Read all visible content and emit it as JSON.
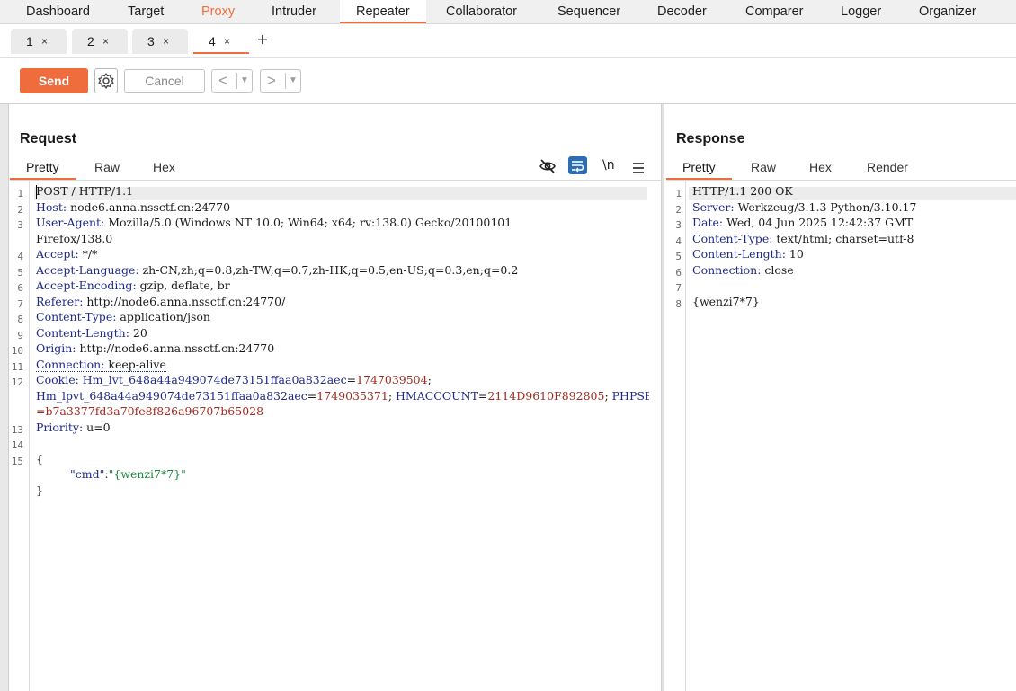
{
  "topnav": {
    "tabs": [
      "Dashboard",
      "Target",
      "Proxy",
      "Intruder",
      "Repeater",
      "Collaborator",
      "Sequencer",
      "Decoder",
      "Comparer",
      "Logger",
      "Organizer"
    ],
    "active": "Repeater",
    "highlight": "Proxy"
  },
  "repeater_tabs": [
    {
      "label": "1",
      "close": "×"
    },
    {
      "label": "2",
      "close": "×"
    },
    {
      "label": "3",
      "close": "×"
    },
    {
      "label": "4",
      "close": "×"
    }
  ],
  "new_tab": "+",
  "toolbar": {
    "send": "Send",
    "settings_icon": "gear-icon",
    "cancel": "Cancel",
    "back": "<",
    "forward": ">",
    "dropdown": "▼"
  },
  "request": {
    "title": "Request",
    "tabs": [
      "Pretty",
      "Raw",
      "Hex"
    ],
    "active_tab": "Pretty",
    "tool_icons": [
      "hide-icon",
      "wrap-icon",
      "newline-icon",
      "menu-icon"
    ],
    "newline_label": "\\n",
    "line_numbers": [
      "1",
      "2",
      "3",
      "4",
      "5",
      "6",
      "7",
      "8",
      "9",
      "10",
      "11",
      "12",
      "13",
      "14",
      "15"
    ],
    "request_line": "POST / HTTP/1.1",
    "headers": [
      {
        "name": "Host",
        "value": "node6.anna.nssctf.cn:24770"
      },
      {
        "name": "User-Agent",
        "value": "Mozilla/5.0 (Windows NT 10.0; Win64; x64; rv:138.0) Gecko/20100101",
        "cont": "Firefox/138.0"
      },
      {
        "name": "Accept",
        "value": "*/*"
      },
      {
        "name": "Accept-Language",
        "value": "zh-CN,zh;q=0.8,zh-TW;q=0.7,zh-HK;q=0.5,en-US;q=0.3,en;q=0.2"
      },
      {
        "name": "Accept-Encoding",
        "value": "gzip, deflate, br"
      },
      {
        "name": "Referer",
        "value": "http://node6.anna.nssctf.cn:24770/"
      },
      {
        "name": "Content-Type",
        "value": "application/json"
      },
      {
        "name": "Content-Length",
        "value": "20"
      },
      {
        "name": "Origin",
        "value": "http://node6.anna.nssctf.cn:24770"
      },
      {
        "name": "Connection",
        "value": "keep-alive"
      }
    ],
    "cookie": {
      "name": "Cookie",
      "c1_name": "Hm_lvt_648a44a949074de73151ffaa0a832aec",
      "c1_value": "1747039504",
      "c2_name": "Hm_lpvt_648a44a949074de73151ffaa0a832aec",
      "c2_value": "1749035371",
      "c3_name": "HMACCOUNT",
      "c3_value": "2114D9610F892805",
      "c4_name": "PHPSE",
      "c4_cont": "=b7a3377fd3a70fe8f826a96707b65028"
    },
    "priority": {
      "name": "Priority",
      "value": "u=0"
    },
    "body": {
      "open": "{",
      "key": "\"cmd\"",
      "colon": ":",
      "value": "\"{wenzi7*7}\"",
      "close": "}"
    }
  },
  "response": {
    "title": "Response",
    "tabs": [
      "Pretty",
      "Raw",
      "Hex",
      "Render"
    ],
    "active_tab": "Pretty",
    "line_numbers": [
      "1",
      "2",
      "3",
      "4",
      "5",
      "6",
      "7",
      "8"
    ],
    "status_line": "HTTP/1.1 200 OK",
    "headers": [
      {
        "name": "Server",
        "value": "Werkzeug/3.1.3 Python/3.10.17"
      },
      {
        "name": "Date",
        "value": "Wed, 04 Jun 2025 12:42:37 GMT"
      },
      {
        "name": "Content-Type",
        "value": "text/html; charset=utf-8"
      },
      {
        "name": "Content-Length",
        "value": "10"
      },
      {
        "name": "Connection",
        "value": "close"
      }
    ],
    "body": "{wenzi7*7}"
  },
  "colors": {
    "accent": "#ef6c3c",
    "header_name": "#1e2a8a",
    "cookie_value": "#a52a1e",
    "json_string": "#1a8a3a"
  }
}
